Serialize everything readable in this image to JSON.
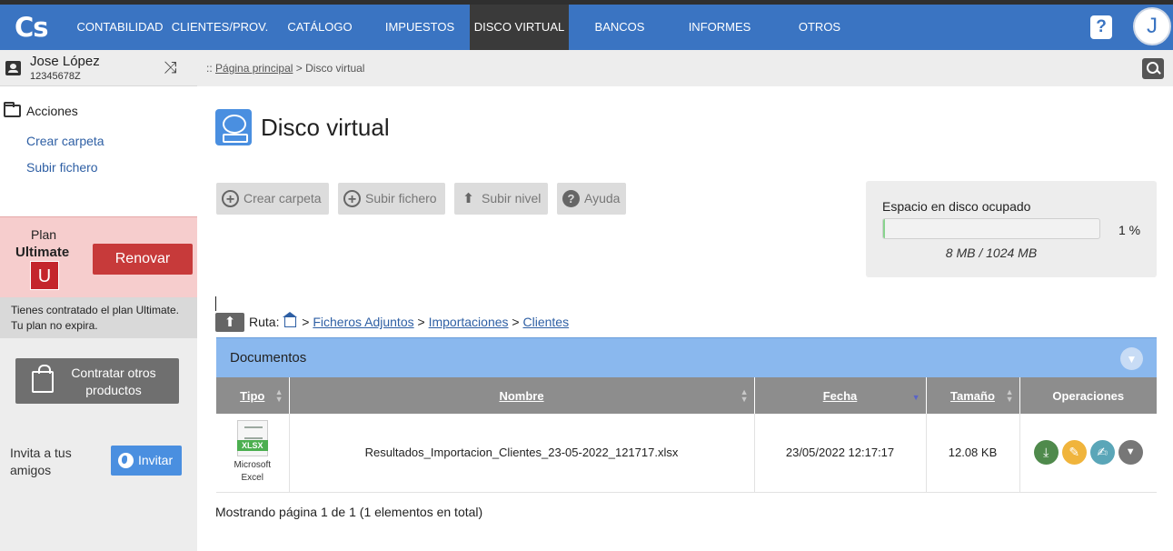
{
  "brand": {
    "logo_text": "Cs"
  },
  "nav": {
    "items": [
      {
        "label": "CONTABILIDAD"
      },
      {
        "label": "CLIENTES/PROV."
      },
      {
        "label": "CATÁLOGO"
      },
      {
        "label": "IMPUESTOS"
      },
      {
        "label": "DISCO VIRTUAL",
        "active": true
      },
      {
        "label": "BANCOS"
      },
      {
        "label": "INFORMES"
      },
      {
        "label": "OTROS"
      }
    ],
    "help_icon": "question-icon",
    "avatar_letter": "J"
  },
  "user": {
    "name": "Jose López",
    "id": "12345678Z",
    "switch_icon": "shuffle-icon"
  },
  "sidebar": {
    "actions_title": "Acciones",
    "actions": [
      {
        "label": "Crear carpeta"
      },
      {
        "label": "Subir fichero"
      }
    ],
    "plan_line1": "Plan",
    "plan_name": "Ultimate",
    "plan_badge": "U",
    "renew_label": "Renovar",
    "plan_note_1": "Tienes contratado el plan Ultimate.",
    "plan_note_2": "Tu plan no expira.",
    "contract_label": "Contratar otros productos",
    "invite_text": "Invita a tus amigos",
    "invite_label": "Invitar"
  },
  "breadcrumb": {
    "prefix": "::",
    "home": "Página principal",
    "separator": ">",
    "current": "Disco virtual"
  },
  "page": {
    "title": "Disco virtual"
  },
  "toolbar": {
    "buttons": [
      {
        "label": "Crear carpeta",
        "icon": "plus-circle-icon"
      },
      {
        "label": "Subir fichero",
        "icon": "plus-circle-icon"
      },
      {
        "label": "Subir nivel",
        "icon": "arrow-up-icon"
      },
      {
        "label": "Ayuda",
        "icon": "question-circle-icon"
      }
    ]
  },
  "disk": {
    "title": "Espacio en disco ocupado",
    "percent_label": "1 %",
    "percent_value": 1,
    "usage": "8 MB / 1024 MB",
    "bar_color": "#89d48e"
  },
  "path": {
    "label": "Ruta:",
    "segments": [
      "Ficheros Adjuntos",
      "Importaciones",
      "Clientes"
    ]
  },
  "documents": {
    "title": "Documentos",
    "columns": [
      "Tipo",
      "Nombre",
      "Fecha",
      "Tamaño",
      "Operaciones"
    ],
    "rows": [
      {
        "type_badge": "XLSX",
        "type_line1": "Microsoft",
        "type_line2": "Excel",
        "name": "Resultados_Importacion_Clientes_23-05-2022_121717.xlsx",
        "date": "23/05/2022 12:17:17",
        "size": "12.08 KB"
      }
    ],
    "operations": [
      {
        "icon": "download-icon",
        "color": "#4f8a4c"
      },
      {
        "icon": "edit-icon",
        "color": "#f0b43c"
      },
      {
        "icon": "sign-icon",
        "color": "#5aa6b8"
      },
      {
        "icon": "chevron-down-icon",
        "color": "#777777"
      }
    ],
    "footer": "Mostrando página 1 de 1 (1 elementos en total)"
  }
}
